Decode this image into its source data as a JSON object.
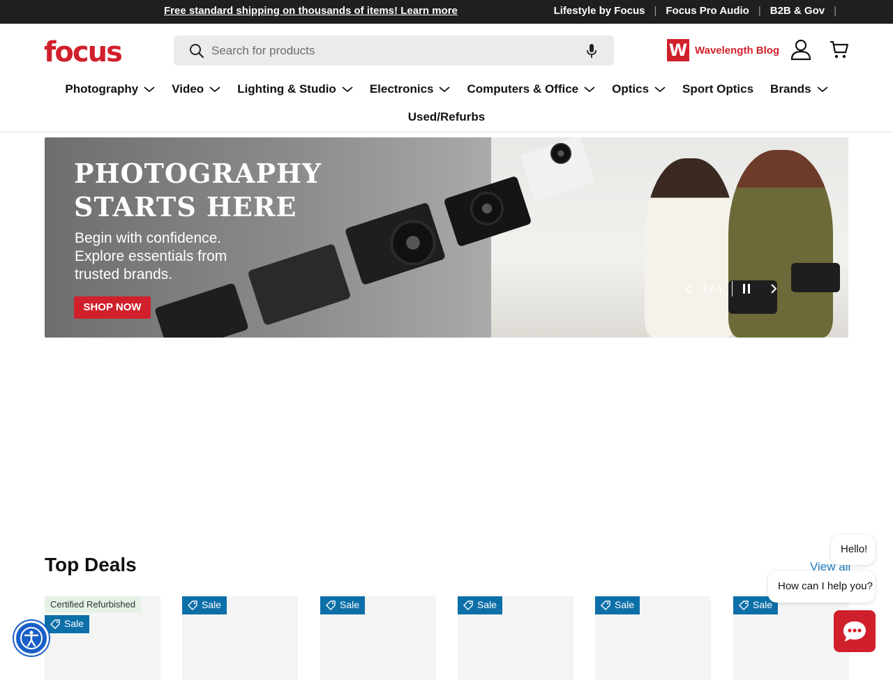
{
  "topbar": {
    "promo": "Free standard shipping on thousands of items! Learn more",
    "links": [
      "Lifestyle by Focus",
      "Focus Pro Audio",
      "B2B & Gov"
    ]
  },
  "header": {
    "logo": "focus",
    "search_placeholder": "Search for products",
    "blog_badge": "W",
    "blog_label": "Wavelength Blog"
  },
  "nav": {
    "items": [
      {
        "label": "Photography",
        "dropdown": true
      },
      {
        "label": "Video",
        "dropdown": true
      },
      {
        "label": "Lighting & Studio",
        "dropdown": true
      },
      {
        "label": "Electronics",
        "dropdown": true
      },
      {
        "label": "Computers & Office",
        "dropdown": true
      },
      {
        "label": "Optics",
        "dropdown": true
      },
      {
        "label": "Sport Optics",
        "dropdown": false
      },
      {
        "label": "Brands",
        "dropdown": true
      }
    ],
    "row2": "Used/Refurbs"
  },
  "hero": {
    "headline_1": "PHOTOGRAPHY",
    "headline_2": "STARTS HERE",
    "subtext": "Begin with confidence. Explore essentials from trusted brands.",
    "cta": "SHOP NOW",
    "slide_counter": "1 / 4"
  },
  "deals": {
    "title": "Top Deals",
    "view_all": "View all",
    "cards": [
      {
        "certified": "Certified Refurbished",
        "sale": "Sale"
      },
      {
        "certified": "",
        "sale": "Sale"
      },
      {
        "certified": "",
        "sale": "Sale"
      },
      {
        "certified": "",
        "sale": "Sale"
      },
      {
        "certified": "",
        "sale": "Sale"
      },
      {
        "certified": "",
        "sale": "Sale"
      }
    ]
  },
  "chat": {
    "greeting": "Hello!",
    "prompt": "How can I help you?"
  },
  "colors": {
    "brand_red": "#d0202b",
    "sale_blue": "#0d6fa8",
    "link_blue": "#1a7bbf",
    "topbar_bg": "#1f1f1f"
  }
}
